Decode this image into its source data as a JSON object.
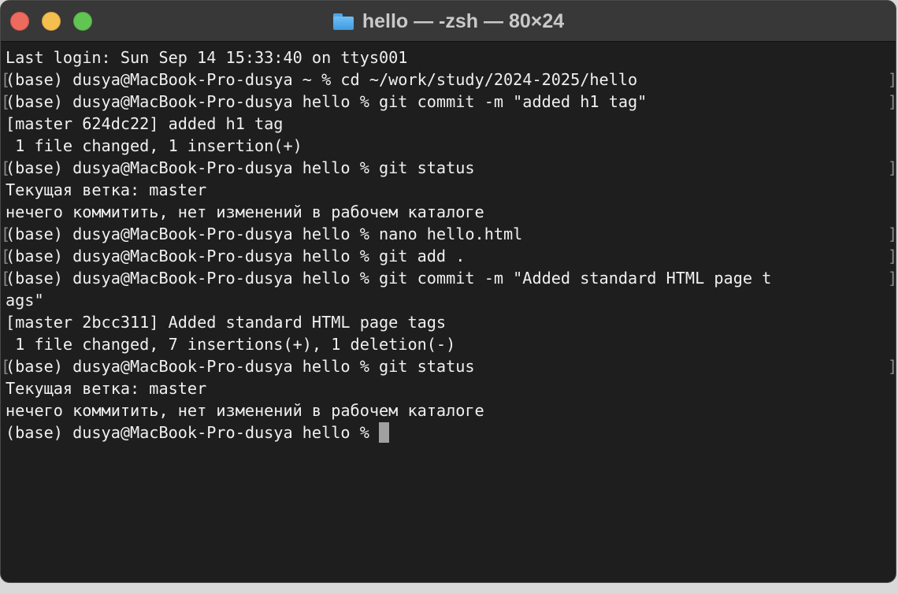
{
  "window": {
    "title": "hello — -zsh — 80×24",
    "buttons": {
      "close": "close",
      "minimize": "minimize",
      "zoom": "zoom"
    }
  },
  "terminal": {
    "lines": [
      {
        "text": "Last login: Sun Sep 14 15:33:40 on ttys001",
        "marked": false
      },
      {
        "text": "(base) dusya@MacBook-Pro-dusya ~ % cd ~/work/study/2024-2025/hello",
        "marked": true
      },
      {
        "text": "(base) dusya@MacBook-Pro-dusya hello % git commit -m \"added h1 tag\"",
        "marked": true
      },
      {
        "text": "[master 624dc22] added h1 tag",
        "marked": false
      },
      {
        "text": " 1 file changed, 1 insertion(+)",
        "marked": false
      },
      {
        "text": "(base) dusya@MacBook-Pro-dusya hello % git status",
        "marked": true
      },
      {
        "text": "Текущая ветка: master",
        "marked": false
      },
      {
        "text": "нечего коммитить, нет изменений в рабочем каталоге",
        "marked": false
      },
      {
        "text": "(base) dusya@MacBook-Pro-dusya hello % nano hello.html",
        "marked": true
      },
      {
        "text": "(base) dusya@MacBook-Pro-dusya hello % git add .",
        "marked": true
      },
      {
        "text": "(base) dusya@MacBook-Pro-dusya hello % git commit -m \"Added standard HTML page t",
        "marked": true
      },
      {
        "text": "ags\"",
        "marked": false
      },
      {
        "text": "[master 2bcc311] Added standard HTML page tags",
        "marked": false
      },
      {
        "text": " 1 file changed, 7 insertions(+), 1 deletion(-)",
        "marked": false
      },
      {
        "text": "(base) dusya@MacBook-Pro-dusya hello % git status",
        "marked": true
      },
      {
        "text": "Текущая ветка: master",
        "marked": false
      },
      {
        "text": "нечего коммитить, нет изменений в рабочем каталоге",
        "marked": false
      }
    ],
    "prompt": "(base) dusya@MacBook-Pro-dusya hello % "
  },
  "colors": {
    "background": "#1e1e1e",
    "text": "#f0f0f0",
    "titlebar": "#383838",
    "cursor": "#a0a0a0"
  },
  "icons": {
    "title_icon": "folder-icon"
  }
}
